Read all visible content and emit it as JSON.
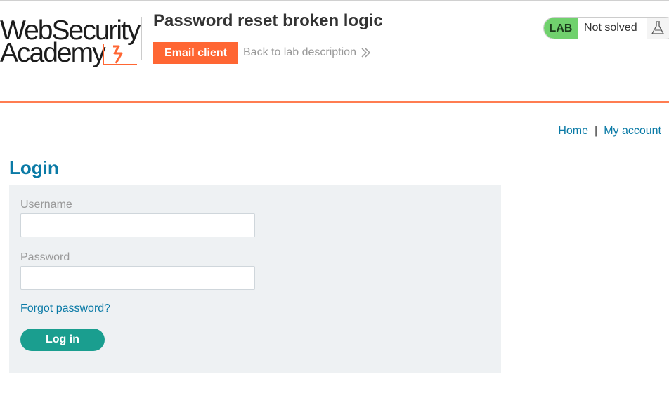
{
  "brand": {
    "logo_line1": "WebSecurity",
    "logo_line2": "Academy",
    "accent_color": "#ff6633"
  },
  "header": {
    "lab_title": "Password reset broken logic",
    "email_client_label": "Email client",
    "back_link_label": "Back to lab description",
    "back_link_icon": "double-chevron-right-icon"
  },
  "status": {
    "badge_label": "LAB",
    "status_text": "Not solved",
    "status_icon": "flask-icon",
    "badge_color": "#70d16d"
  },
  "nav": {
    "home_label": "Home",
    "separator": "|",
    "account_label": "My account"
  },
  "login": {
    "heading": "Login",
    "username_label": "Username",
    "username_value": "",
    "password_label": "Password",
    "password_value": "",
    "forgot_label": "Forgot password?",
    "submit_label": "Log in",
    "submit_color": "#1a9e8f"
  }
}
